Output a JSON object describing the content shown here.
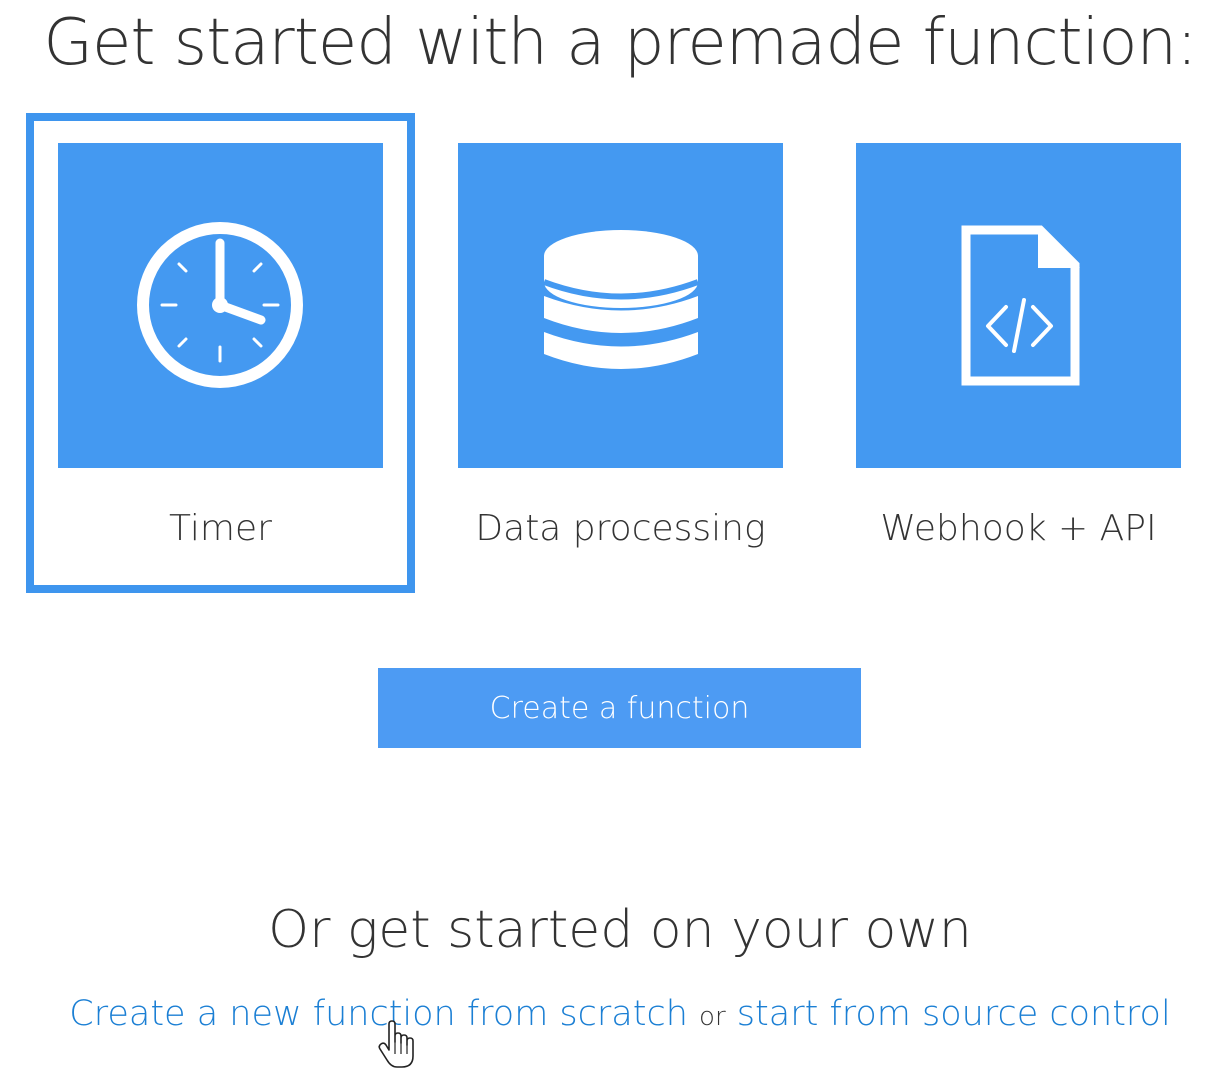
{
  "header": {
    "title": "Get started with a premade function:"
  },
  "templates": [
    {
      "label": "Timer",
      "icon": "clock-icon",
      "selected": true
    },
    {
      "label": "Data processing",
      "icon": "database-icon",
      "selected": false
    },
    {
      "label": "Webhook + API",
      "icon": "code-file-icon",
      "selected": false
    }
  ],
  "actions": {
    "create_label": "Create a function"
  },
  "own": {
    "title": "Or get started on your own",
    "scratch_link": "Create a new function from scratch",
    "or_text": "or",
    "source_link": "start from source control"
  },
  "colors": {
    "tile": "#4499f1",
    "selection_border": "#3e95ee",
    "button": "#4d9bf3",
    "link": "#1b7fd4"
  }
}
